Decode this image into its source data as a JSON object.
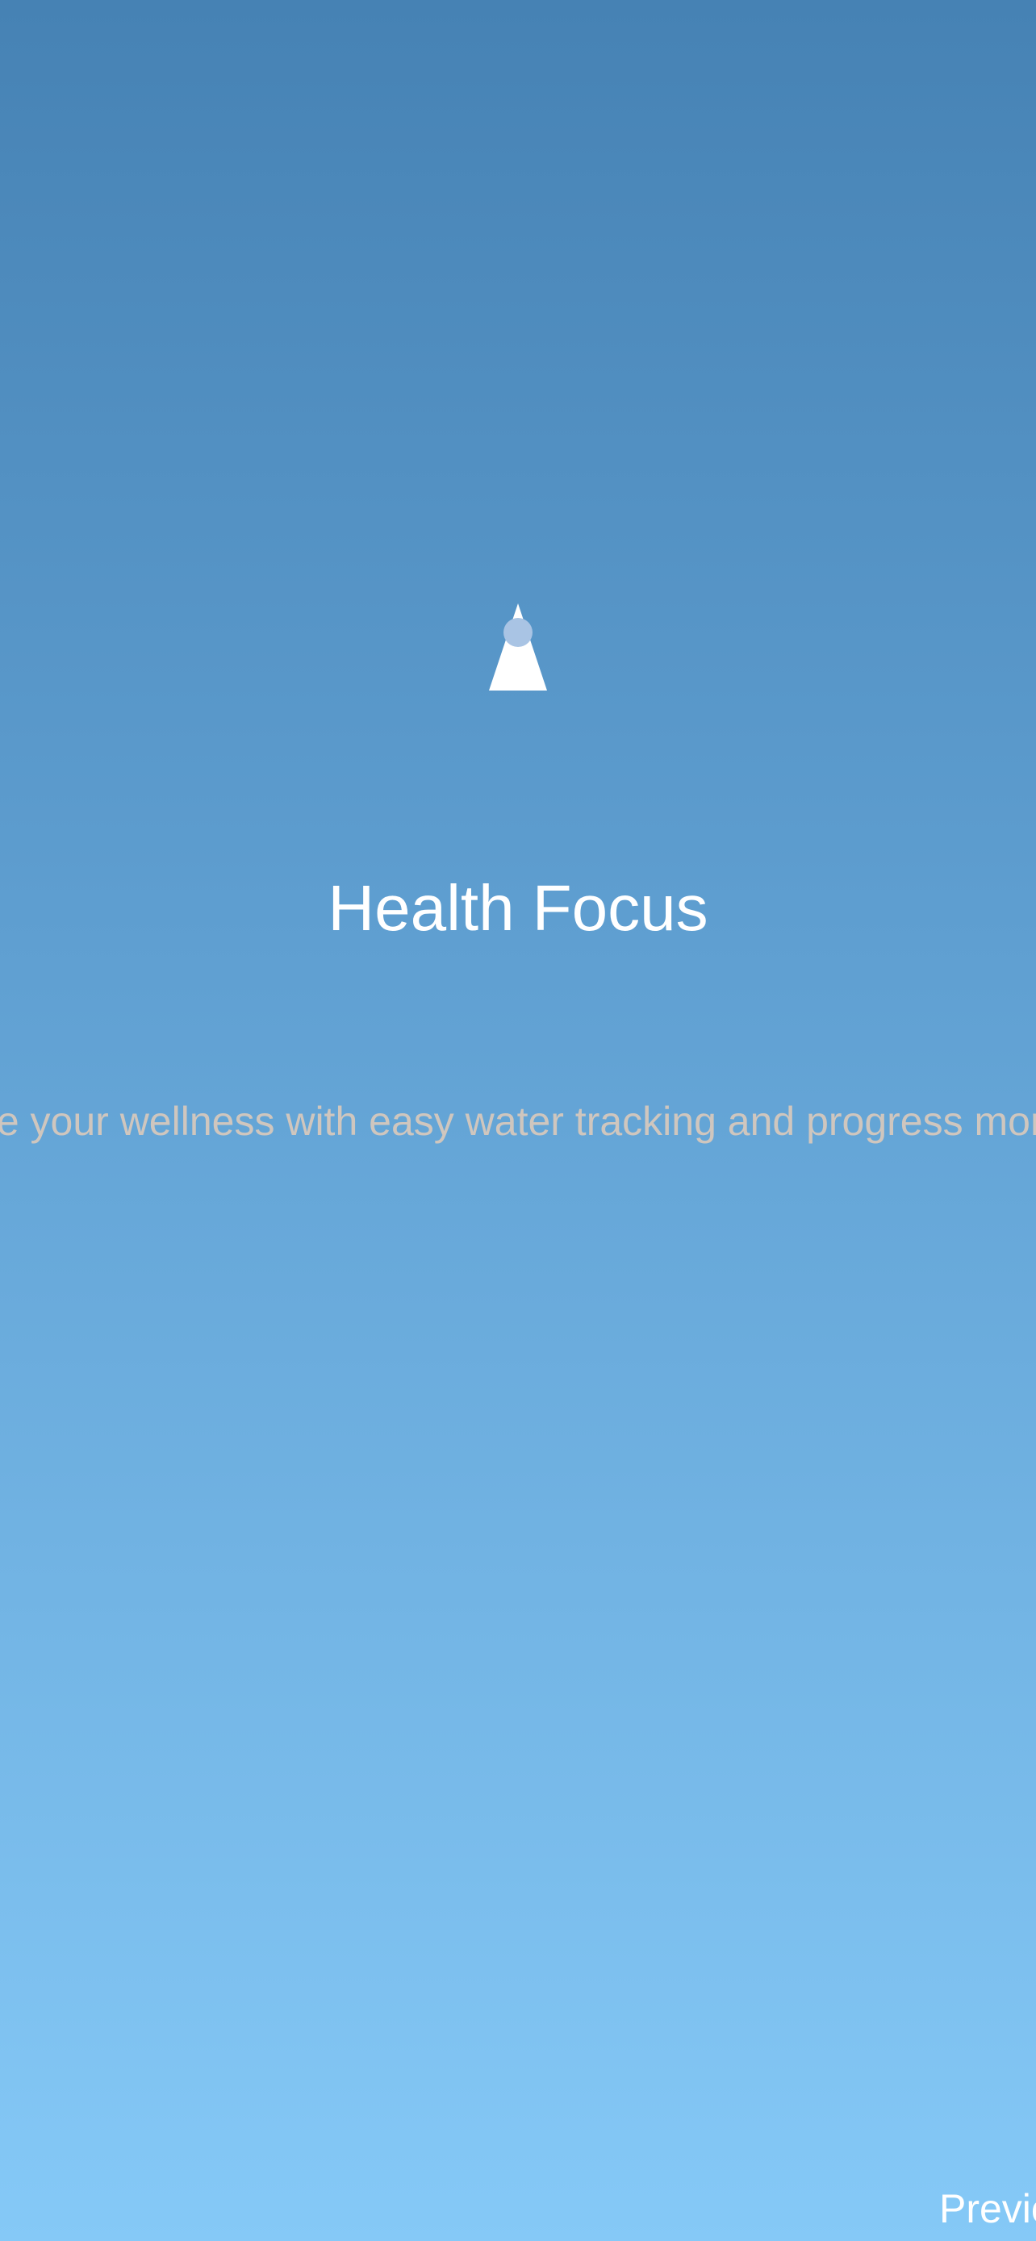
{
  "onboarding": {
    "icon": "water-drop-icon",
    "title": "Health Focus",
    "subtitle": "Improve your wellness with easy water tracking and progress monitoring",
    "previous_label": "Previous",
    "colors": {
      "gradient_top": "#4682b4",
      "gradient_bottom": "#85c9f7",
      "title_text": "#ffffff",
      "subtitle_text": "#cfc6be",
      "icon_fill": "#ffffff",
      "icon_accent": "#a9c4e4"
    }
  }
}
